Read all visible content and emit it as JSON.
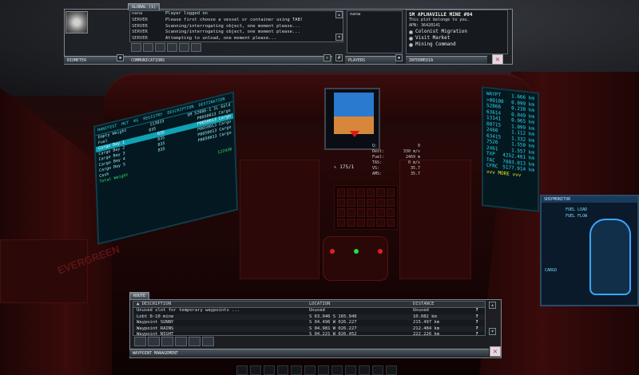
{
  "biometer": {
    "label": "BIOMETER"
  },
  "communications": {
    "tab_label": "GLOBAL (1)",
    "footer_label": "COMMUNICATIONS",
    "messages": [
      {
        "sender": "nana",
        "text": "Player logged on"
      },
      {
        "sender": "SERVER",
        "text": "Please first choose a vessel or container using TAB!"
      },
      {
        "sender": "SERVER",
        "text": "Scanning/interrogating object, one moment please..."
      },
      {
        "sender": "SERVER",
        "text": "Scanning/interrogating object, one moment please..."
      },
      {
        "sender": "SERVER",
        "text": "Attempting to unload, one moment please..."
      }
    ]
  },
  "players": {
    "footer_label": "PLAYERS",
    "list": [
      "nana"
    ]
  },
  "intermedia": {
    "footer_label": "INTERMEDIA",
    "title": "SM APLHAVILLE MINE #04",
    "subtitle": "This plot belonge to you.",
    "apn": "APN: 36420141",
    "options": [
      "Colonist Migration",
      "Visit Market",
      "Mining Command"
    ]
  },
  "manifest": {
    "title": "MANIFEST",
    "headers": [
      "MCT",
      "KG",
      "REGISTRY",
      "DESCRIPTION",
      "DESTINATION"
    ],
    "rows": [
      {
        "label": "Empty Weight",
        "value": "113033",
        "extra": "SM 52086-1 1L Gold",
        "selected": false
      },
      {
        "label": "Fuel",
        "value": "835",
        "extra": "P0050013 Cargo",
        "selected": false
      },
      {
        "label": "Cargo Bay 1",
        "value": "835",
        "extra": "P0050013 Cargo",
        "selected": true
      },
      {
        "label": "Cargo Bay 2",
        "value": "835",
        "extra": "P0050013 Cargo",
        "selected": false
      },
      {
        "label": "Cargo Bay 3",
        "value": "835",
        "extra": "P0050013 Cargo",
        "selected": false
      },
      {
        "label": "Cargo Bay 4",
        "value": "835",
        "extra": "P0050013 Cargo",
        "selected": false
      },
      {
        "label": "Cargo Bay 5",
        "value": "",
        "extra": "",
        "selected": false
      },
      {
        "label": "Cash",
        "value": "",
        "extra": "",
        "selected": false
      },
      {
        "label": "Total Weight",
        "value": "122436",
        "extra": "",
        "selected": false,
        "total": true
      }
    ]
  },
  "hud": {
    "heading": "175/1",
    "readouts": [
      {
        "k": "Q:",
        "v": "0"
      },
      {
        "k": "Dest:",
        "v": "330 m/s"
      },
      {
        "k": "Fuel:",
        "v": "2469 m"
      },
      {
        "k": "TAS:",
        "v": "0 m/s"
      },
      {
        "k": "VS:",
        "v": "35.7"
      },
      {
        "k": "AMS:",
        "v": "35.7"
      }
    ]
  },
  "waypoint_screen": {
    "title": "WAYPT",
    "rows": [
      {
        "id": "WAYPT",
        "dist": "1.666 km"
      },
      {
        "id": ">00100",
        "dist": "0.099 km"
      },
      {
        "id": "52866",
        "dist": "0.238 km"
      },
      {
        "id": "63614",
        "dist": "0.849 km"
      },
      {
        "id": "13141",
        "dist": "0.965 km"
      },
      {
        "id": "00715",
        "dist": "1.099 km"
      },
      {
        "id": "2460",
        "dist": "1.112 km"
      },
      {
        "id": "63415",
        "dist": "1.332 km"
      },
      {
        "id": "7526",
        "dist": "1.550 km"
      },
      {
        "id": "2461",
        "dist": "1.557 km"
      },
      {
        "id": "TXP",
        "dist": "4252.461 km"
      },
      {
        "id": "TAC",
        "dist": "7003.013 km"
      },
      {
        "id": "CFRC",
        "dist": "5177.914 km"
      }
    ],
    "more": "vvv MORE vvv"
  },
  "ship_monitor": {
    "title": "SHIPMONITOR",
    "labels": [
      "FUEL LOAD",
      "FUEL FLOW",
      "CARGO"
    ]
  },
  "route": {
    "tab_label": "ROUTE",
    "footer_label": "WAYPOINT MANAGEMENT",
    "headers": {
      "desc": "▲ DESCRIPTION",
      "loc": "LOCATION",
      "dist": "DISTANCE"
    },
    "rows": [
      {
        "desc": "Unused slot for temporary waypoints ...",
        "loc": "Unused",
        "dist": "Unused"
      },
      {
        "desc": "Lobt 0-10 mine",
        "loc": "S 63.946 S 165.940",
        "dist": "10.082 km"
      },
      {
        "desc": "Waypoint SUNNY",
        "loc": "S 04.496 W 026.227",
        "dist": "215.497 km"
      },
      {
        "desc": "Waypoint RAINS",
        "loc": "S 04.981 W 026.227",
        "dist": "212.484 km"
      },
      {
        "desc": "Waypoint NIGHT",
        "loc": "S 04.221 W 026.452",
        "dist": "222.226 km"
      }
    ]
  },
  "scene": {
    "decal": "EVERGREEN"
  }
}
